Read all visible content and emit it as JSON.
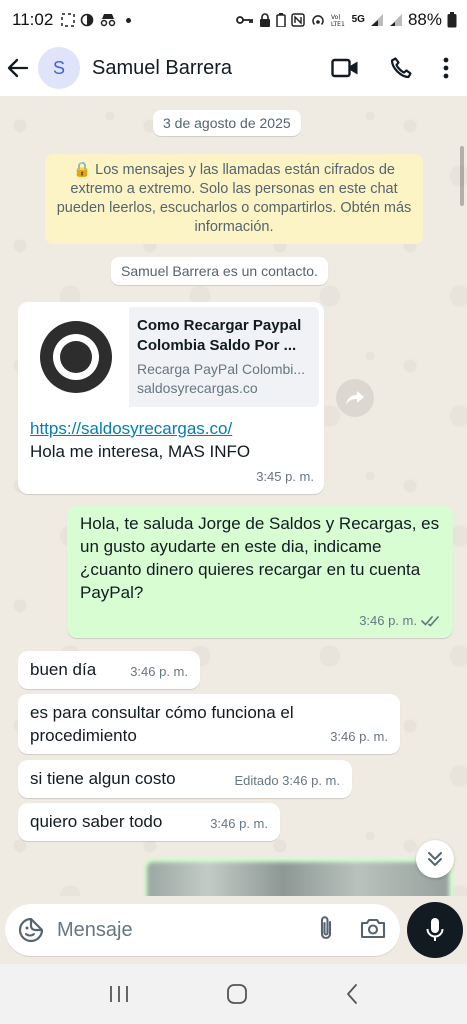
{
  "status_bar": {
    "time": "11:02",
    "battery_percent": "88%",
    "network_label": "5G"
  },
  "header": {
    "avatar_initial": "S",
    "contact_name": "Samuel Barrera"
  },
  "chat": {
    "date_chip": "3 de agosto de 2025",
    "encryption_notice": "🔒 Los mensajes y las llamadas están cifrados de extremo a extremo. Solo las personas en este chat pueden leerlos, escucharlos o compartirlos. Obtén más información.",
    "contact_notice": "Samuel Barrera es un contacto.",
    "link_message": {
      "preview_title": "Como Recargar Paypal Colombia Saldo Por ...",
      "preview_description": "Recarga PayPal Colombi...",
      "preview_domain": "saldosyrecargas.co",
      "url": "https://saldosyrecargas.co/",
      "text": "Hola me interesa, MAS INFO",
      "time": "3:45 p. m."
    },
    "outgoing_message": {
      "text": "Hola, te saluda Jorge de Saldos y Recargas, es un gusto ayudarte en este dia, indicame ¿cuanto dinero quieres recargar en tu cuenta PayPal?",
      "time": "3:46 p. m."
    },
    "incoming_messages": [
      {
        "text": "buen día",
        "time": "3:46 p. m."
      },
      {
        "text": "es para consultar cómo funciona el procedimiento",
        "time": "3:46 p. m."
      },
      {
        "text": "si tiene algun costo",
        "time": "Editado 3:46 p. m."
      },
      {
        "text": "quiero saber todo",
        "time": "3:46 p. m."
      }
    ]
  },
  "input": {
    "placeholder": "Mensaje"
  },
  "colors": {
    "outgoing_bubble": "#d9fdd3",
    "incoming_bubble": "#ffffff",
    "link": "#027eb5",
    "chat_background": "#efeae2",
    "mic_button": "#111b21"
  }
}
